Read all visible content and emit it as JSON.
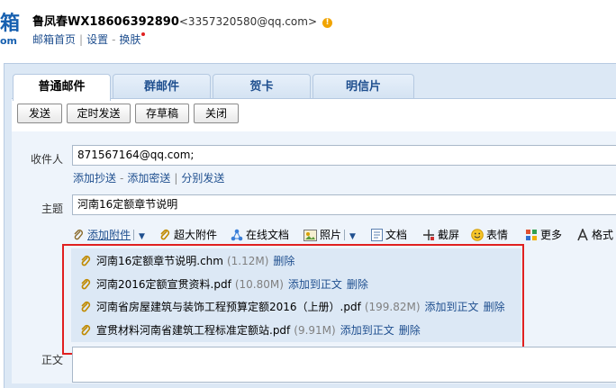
{
  "header": {
    "logo_text": "箱",
    "logo_sub": "om",
    "user_name": "鲁凤春WX18606392890",
    "user_email": "<3357320580@qq.com>",
    "warn_glyph": "!",
    "nav": {
      "home": "邮箱首页",
      "settings": "设置",
      "skin": "换肤"
    }
  },
  "tabs": [
    "普通邮件",
    "群邮件",
    "贺卡",
    "明信片"
  ],
  "toolbar": {
    "send": "发送",
    "schedule": "定时发送",
    "draft": "存草稿",
    "close": "关闭"
  },
  "form": {
    "recipient_label": "收件人",
    "recipient_value": "871567164@qq.com;",
    "add_cc": "添加抄送",
    "add_bcc": "添加密送",
    "separate_send": "分别发送",
    "subject_label": "主题",
    "subject_value": "河南16定额章节说明",
    "body_label": "正文"
  },
  "attach_toolbar": {
    "add_attachment": "添加附件",
    "super_attachment": "超大附件",
    "online_doc": "在线文档",
    "photo": "照片",
    "document": "文档",
    "screenshot": "截屏",
    "emoji": "表情",
    "more": "更多",
    "format": "格式"
  },
  "attachments": [
    {
      "name": "河南16定额章节说明.chm",
      "size": "(1.12M)",
      "add_to_body": "",
      "delete": "删除"
    },
    {
      "name": "河南2016定额宣贯资料.pdf",
      "size": "(10.80M)",
      "add_to_body": "添加到正文",
      "delete": "删除"
    },
    {
      "name": "河南省房屋建筑与装饰工程预算定额2016（上册）.pdf",
      "size": "(199.82M)",
      "add_to_body": "添加到正文",
      "delete": "删除"
    },
    {
      "name": "宣贯材料河南省建筑工程标准定额站.pdf",
      "size": "(9.91M)",
      "add_to_body": "添加到正文",
      "delete": "删除"
    }
  ],
  "colors": {
    "link": "#1f4f8f",
    "highlight": "#e02020",
    "panel": "#dce8f5"
  }
}
